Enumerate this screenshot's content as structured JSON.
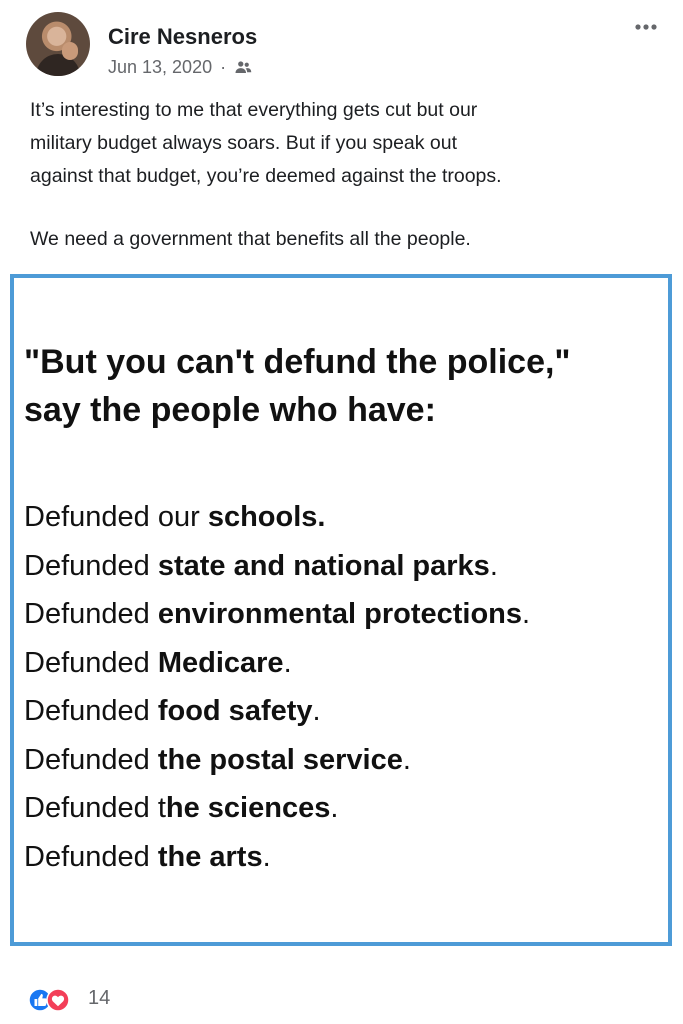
{
  "post": {
    "author": "Cire Nesneros",
    "date": "Jun 13, 2020",
    "separator": "·",
    "audience_icon": "friends-icon",
    "more_icon": "more-options-icon",
    "caption": {
      "line1": "It’s interesting to me that everything gets cut but our",
      "line2": "military budget always soars. But if you speak out",
      "line3": "against that budget, you’re deemed against the troops.",
      "line4": "We need a government that benefits all the people."
    }
  },
  "image": {
    "heading_line1": "\"But you can't defund the police,\"",
    "heading_line2": "say the people who have:",
    "items": [
      {
        "prefix": "Defunded our ",
        "bold": "schools.",
        "suffix": ""
      },
      {
        "prefix": "Defunded ",
        "bold": "state and national parks",
        "suffix": "."
      },
      {
        "prefix": "Defunded ",
        "bold": "environmental protections",
        "suffix": "."
      },
      {
        "prefix": "Defunded ",
        "bold": "Medicare",
        "suffix": "."
      },
      {
        "prefix": "Defunded ",
        "bold": "food safety",
        "suffix": "."
      },
      {
        "prefix": "Defunded ",
        "bold": "the postal service",
        "suffix": "."
      },
      {
        "prefix": "Defunded t",
        "bold": "he sciences",
        "suffix": "."
      },
      {
        "prefix": "Defunded ",
        "bold": "the arts",
        "suffix": "."
      }
    ],
    "border_color": "#4d9bd7"
  },
  "reactions": {
    "count": "14",
    "icons": [
      "like-icon",
      "love-icon"
    ],
    "like_color": "#1877f2",
    "love_color": "#f33e58"
  }
}
